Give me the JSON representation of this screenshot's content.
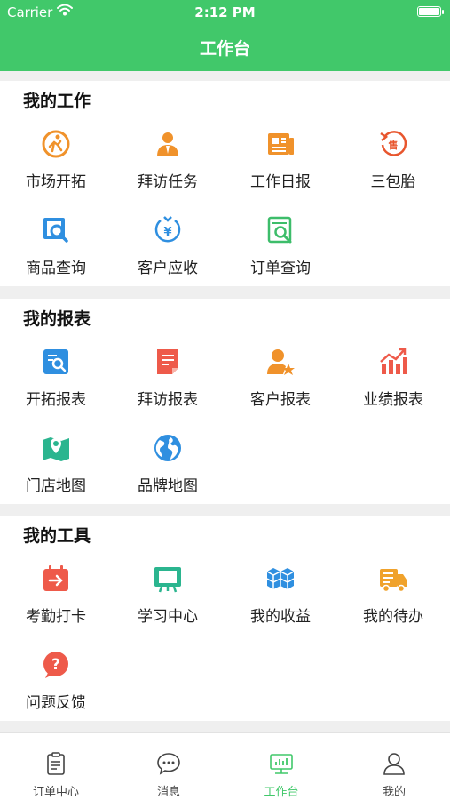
{
  "status_bar": {
    "carrier": "Carrier",
    "time": "2:12 PM",
    "battery_level": 0.9
  },
  "header": {
    "title": "工作台"
  },
  "sections": [
    {
      "title": "我的工作",
      "items": [
        {
          "label": "市场开拓",
          "icon": "running-man-icon",
          "color": "#f0922b"
        },
        {
          "label": "拜访任务",
          "icon": "businessman-icon",
          "color": "#f0922b"
        },
        {
          "label": "工作日报",
          "icon": "newspaper-icon",
          "color": "#f0922b"
        },
        {
          "label": "三包胎",
          "icon": "return-sale-icon",
          "color": "#e8562e"
        },
        {
          "label": "商品查询",
          "icon": "product-search-icon",
          "color": "#2f8fe0"
        },
        {
          "label": "客户应收",
          "icon": "yen-receivable-icon",
          "color": "#2f8fe0"
        },
        {
          "label": "订单查询",
          "icon": "order-search-icon",
          "color": "#3dbd6a"
        }
      ]
    },
    {
      "title": "我的报表",
      "items": [
        {
          "label": "开拓报表",
          "icon": "report-search-icon",
          "color": "#2f8fe0"
        },
        {
          "label": "拜访报表",
          "icon": "document-icon",
          "color": "#ee5a4a"
        },
        {
          "label": "客户报表",
          "icon": "customer-star-icon",
          "color": "#f0922b"
        },
        {
          "label": "业绩报表",
          "icon": "bar-chart-icon",
          "color": "#ee5a4a"
        },
        {
          "label": "门店地图",
          "icon": "map-pin-icon",
          "color": "#2bb58f"
        },
        {
          "label": "品牌地图",
          "icon": "globe-icon",
          "color": "#2f8fe0"
        }
      ]
    },
    {
      "title": "我的工具",
      "items": [
        {
          "label": "考勤打卡",
          "icon": "calendar-checkin-icon",
          "color": "#ee5a4a"
        },
        {
          "label": "学习中心",
          "icon": "easel-icon",
          "color": "#2bb58f"
        },
        {
          "label": "我的收益",
          "icon": "cubes-icon",
          "color": "#2f8fe0"
        },
        {
          "label": "我的待办",
          "icon": "delivery-truck-icon",
          "color": "#f0a22b"
        },
        {
          "label": "问题反馈",
          "icon": "question-bubble-icon",
          "color": "#ee5a4a"
        }
      ]
    }
  ],
  "tabbar": {
    "tabs": [
      {
        "label": "订单中心",
        "icon": "clipboard-icon"
      },
      {
        "label": "消息",
        "icon": "chat-bubble-icon"
      },
      {
        "label": "工作台",
        "icon": "monitor-chart-icon"
      },
      {
        "label": "我的",
        "icon": "person-icon"
      }
    ],
    "active_index": 2,
    "active_color": "#41c86a",
    "inactive_color": "#444444"
  },
  "colors": {
    "brand": "#41c86a",
    "background": "#efefef"
  }
}
